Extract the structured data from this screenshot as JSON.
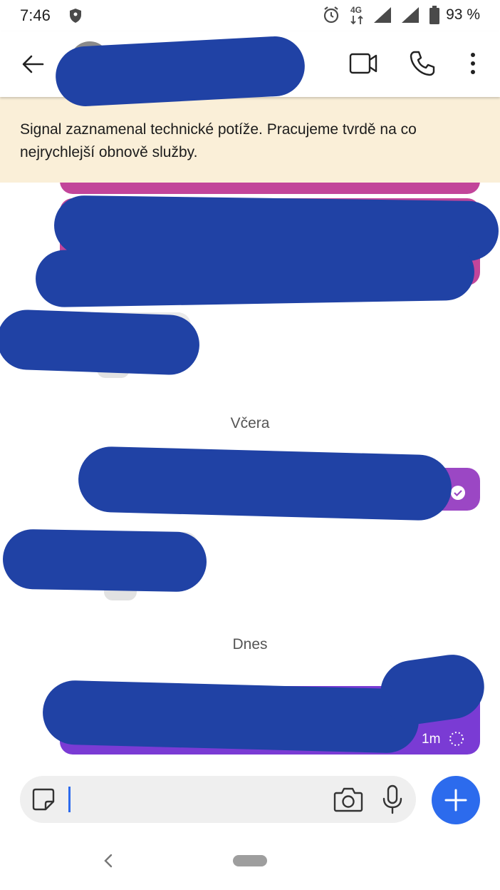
{
  "status_bar": {
    "time": "7:46",
    "network": "4G",
    "battery": "93 %"
  },
  "conversation": {
    "contact_name": ""
  },
  "banner": {
    "text": "Signal zaznamenal technické potíže. Pracujeme tvrdě na co nejrychlejší obnově služby."
  },
  "timeline": {
    "separators": [
      "Včera",
      "Dnes"
    ],
    "last_message_time": "1m"
  },
  "colors": {
    "accent": "#2c6bed",
    "bubble_pink": "#c2459a",
    "bubble_purple": "#9b47c4",
    "bubble_violet": "#7a3bd4",
    "banner_bg": "#faefd8",
    "redaction": "#2042a5"
  }
}
